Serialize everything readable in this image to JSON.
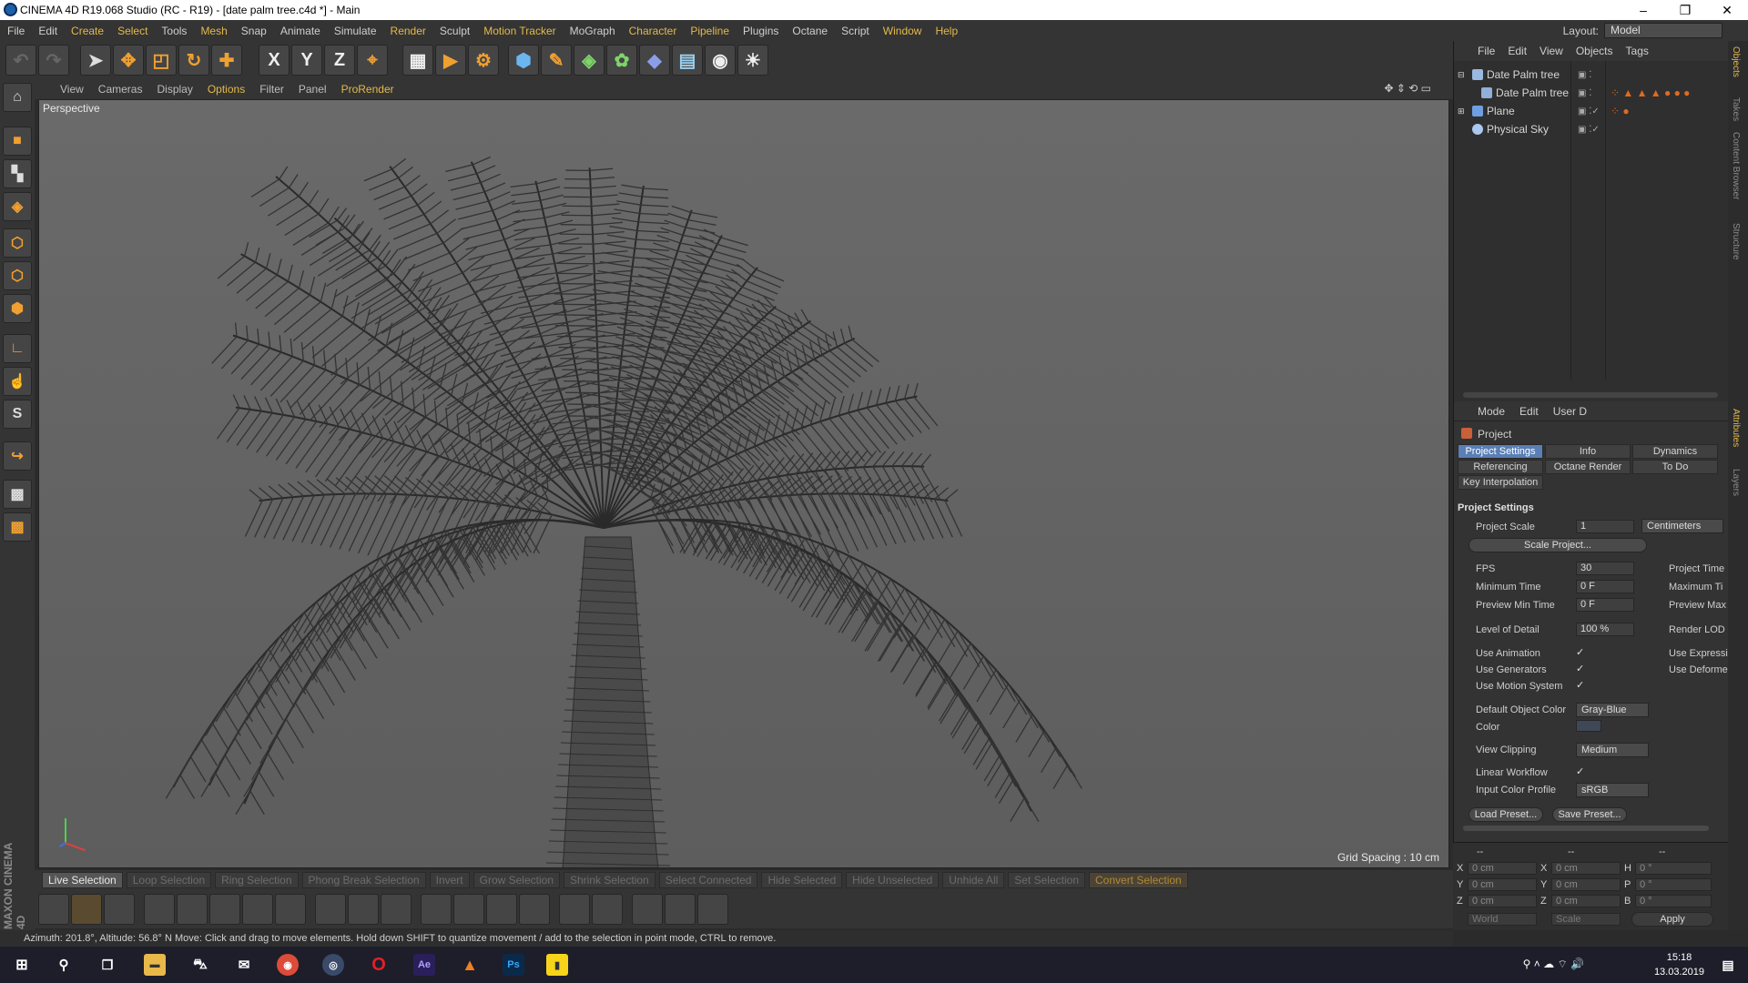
{
  "window": {
    "title": "CINEMA 4D R19.068 Studio (RC - R19) - [date palm tree.c4d *] - Main"
  },
  "menubar": [
    "File",
    "Edit",
    "Create",
    "Select",
    "Tools",
    "Mesh",
    "Snap",
    "Animate",
    "Simulate",
    "Render",
    "Sculpt",
    "Motion Tracker",
    "MoGraph",
    "Character",
    "Pipeline",
    "Plugins",
    "Octane",
    "Script",
    "Window",
    "Help"
  ],
  "layout": {
    "label": "Layout:",
    "value": "Model"
  },
  "toolbar_axes": [
    "X",
    "Y",
    "Z"
  ],
  "viewport": {
    "menu": [
      "View",
      "Cameras",
      "Display",
      "Options",
      "Filter",
      "Panel",
      "ProRender"
    ],
    "camera_label": "Perspective",
    "grid_spacing": "Grid Spacing : 10 cm"
  },
  "selection_bar": [
    "Live Selection",
    "Loop Selection",
    "Ring Selection",
    "Phong Break Selection",
    "Invert",
    "Grow Selection",
    "Shrink Selection",
    "Select Connected",
    "Hide Selected",
    "Hide Unselected",
    "Unhide All",
    "Set Selection",
    "Convert Selection"
  ],
  "status": "Azimuth: 201.8°, Altitude: 56.8°  N   Move: Click and drag to move elements. Hold down SHIFT to quantize movement / add to the selection in point mode, CTRL to remove.",
  "objects": {
    "menu": [
      "File",
      "Edit",
      "View",
      "Objects",
      "Tags"
    ],
    "items": [
      {
        "name": "Date Palm tree"
      },
      {
        "name": "Date Palm tree"
      },
      {
        "name": "Plane"
      },
      {
        "name": "Physical Sky"
      }
    ]
  },
  "attributes": {
    "menu": [
      "Mode",
      "Edit",
      "User D"
    ],
    "header": "Project",
    "tabs": [
      "Project Settings",
      "Info",
      "Dynamics",
      "Referencing",
      "Octane Render",
      "To Do",
      "Key Interpolation"
    ],
    "section": "Project Settings",
    "project_scale_label": "Project Scale",
    "project_scale_value": "1",
    "project_scale_unit": "Centimeters",
    "scale_project_button": "Scale Project...",
    "fps_label": "FPS",
    "fps_value": "30",
    "project_time_label": "Project Time",
    "min_time_label": "Minimum Time",
    "min_time_value": "0 F",
    "max_time_label": "Maximum Ti",
    "preview_min_label": "Preview Min Time",
    "preview_min_value": "0 F",
    "preview_max_label": "Preview Max",
    "lod_label": "Level of Detail",
    "lod_value": "100 %",
    "render_lod_label": "Render LOD",
    "use_animation_label": "Use Animation",
    "use_expression_label": "Use Expressi",
    "use_generators_label": "Use Generators",
    "use_deformers_label": "Use Deforme",
    "use_motion_label": "Use Motion System",
    "default_color_label": "Default Object Color",
    "default_color_value": "Gray-Blue",
    "color_label": "Color",
    "view_clipping_label": "View Clipping",
    "view_clipping_value": "Medium",
    "linear_workflow_label": "Linear Workflow",
    "input_profile_label": "Input Color Profile",
    "input_profile_value": "sRGB",
    "load_preset": "Load Preset...",
    "save_preset": "Save Preset..."
  },
  "coords": {
    "headers": [
      "--",
      "--",
      "--"
    ],
    "pos_axes": [
      "X",
      "Y",
      "Z"
    ],
    "size_axes": [
      "X",
      "Y",
      "Z"
    ],
    "rot_axes": [
      "H",
      "P",
      "B"
    ],
    "pos_values": [
      "0 cm",
      "0 cm",
      "0 cm"
    ],
    "size_values": [
      "0 cm",
      "0 cm",
      "0 cm"
    ],
    "rot_values": [
      "0 °",
      "0 °",
      "0 °"
    ],
    "world": "World",
    "scale": "Scale",
    "apply": "Apply"
  },
  "right_tabs": [
    "Objects",
    "Takes",
    "Content Browser",
    "Structure",
    "Attributes",
    "Layers"
  ],
  "clock": {
    "time": "15:18",
    "date": "13.03.2019"
  }
}
